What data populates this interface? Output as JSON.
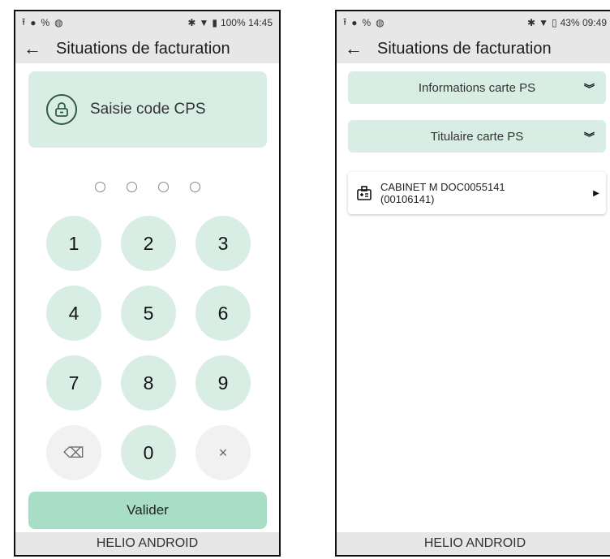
{
  "phone1": {
    "status": {
      "right_text": "100% 14:45"
    },
    "appbar": {
      "title": "Situations de facturation"
    },
    "cps_card": {
      "label": "Saisie code CPS"
    },
    "keypad": {
      "keys": [
        "1",
        "2",
        "3",
        "4",
        "5",
        "6",
        "7",
        "8",
        "9",
        "⌫",
        "0",
        "×"
      ]
    },
    "valider_label": "Valider",
    "footer": "HELIO ANDROID"
  },
  "phone2": {
    "status": {
      "right_text": "43% 09:49"
    },
    "appbar": {
      "title": "Situations de facturation"
    },
    "accordion1": {
      "label": "Informations carte PS"
    },
    "accordion2": {
      "label": "Titulaire carte PS"
    },
    "list_item": {
      "line1": "CABINET M DOC0055141",
      "line2": "(00106141)"
    },
    "footer": "HELIO ANDROID"
  },
  "colors": {
    "accent_light": "#d8eee4",
    "accent_button": "#a9dec6",
    "bar_grey": "#e7e7e7"
  },
  "icons": [
    "back-arrow-icon",
    "lock-icon",
    "backspace-icon",
    "clear-icon",
    "double-chevron-down-icon",
    "id-card-icon",
    "caret-right-icon"
  ]
}
